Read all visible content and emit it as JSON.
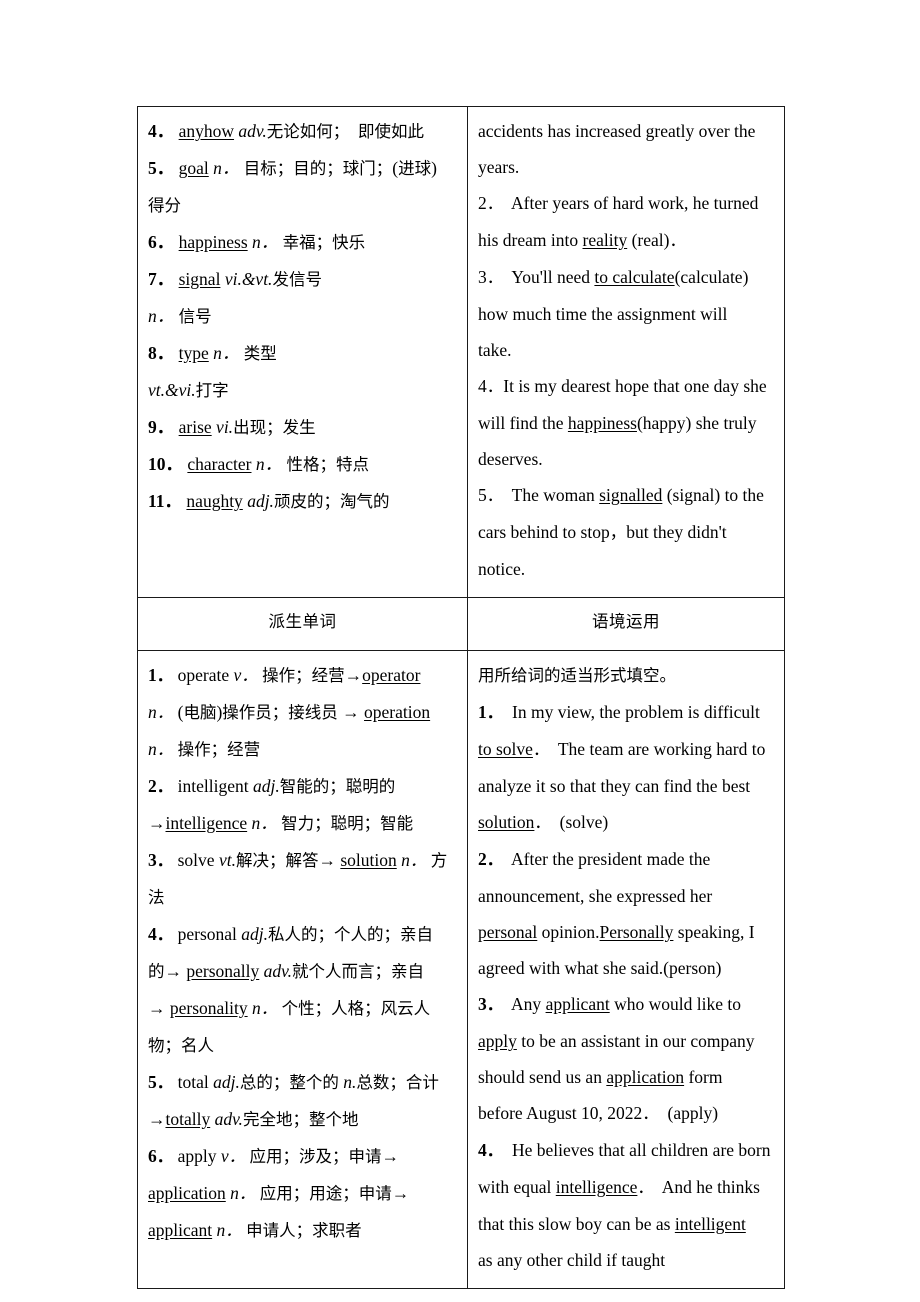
{
  "table": {
    "columns": [
      {
        "key": "left",
        "heading": "派生单词"
      },
      {
        "key": "right",
        "heading": "语境运用"
      }
    ],
    "row_words": {
      "left_cell": {
        "name": "word-list",
        "lines": [
          {
            "num": "4．",
            "word": "anyhow",
            "pos": "adv.",
            "gloss": "无论如何；  即使如此"
          },
          {
            "num": "5．",
            "word": "goal",
            "pos": "n．",
            "gloss": " 目标；目的；球门；(进球)"
          },
          {
            "num": "",
            "word": "",
            "pos": "",
            "gloss": "得分"
          },
          {
            "num": "6．",
            "word": "happiness",
            "pos": "n．",
            "gloss": " 幸福；快乐"
          },
          {
            "num": "7．",
            "word": "signal",
            "pos": "vi.&vt.",
            "gloss": "发信号"
          },
          {
            "num": "",
            "word": "",
            "pos": "n．",
            "gloss": " 信号"
          },
          {
            "num": "8．",
            "word": "type",
            "pos": "n．",
            "gloss": " 类型"
          },
          {
            "num": "",
            "word": "",
            "pos": "vt.&vi.",
            "gloss": "打字"
          },
          {
            "num": "9．",
            "word": "arise",
            "pos": "vi.",
            "gloss": "出现；发生"
          },
          {
            "num": "10．",
            "word": "character",
            "pos": "n．",
            "gloss": " 性格；特点"
          },
          {
            "num": "11．",
            "word": "naughty",
            "pos": "adj.",
            "gloss": "顽皮的；淘气的"
          }
        ]
      },
      "right_cell": {
        "name": "context-sentences-top",
        "lines": [
          "accidents has increased greatly over the",
          "years.",
          "2．  After years of hard work, he turned",
          "his dream into [[reality]] (real)．",
          "3．  You'll need [[to calculate]](calculate)",
          "how much time the assignment will",
          "take.",
          "4．It is my dearest hope that one day she",
          "will find the [[happiness]](happy) she truly",
          "deserves.",
          "5．  The woman [[signalled]] (signal) to the",
          "cars behind to stop，but they didn't",
          "notice."
        ]
      }
    },
    "row_derived": {
      "left_cell": {
        "name": "derived-word-list",
        "lines": [
          "[[b:1．]] operate [[i:v．]] 操作；经营→[[u:operator]]",
          "[[i:n．]] (电脑)操作员；接线员 → [[u:operation]]",
          "[[i:n．]] 操作；经营",
          "[[b:2．]] intelligent [[i:adj.]]智能的；聪明的",
          "→[[u:intelligence]] [[i:n．]] 智力；聪明；智能",
          "[[b:3．]] solve [[i:vt.]]解决；解答→ [[u:solution]] [[i:n．]] 方",
          "法",
          "[[b:4．]] personal [[i:adj.]]私人的；个人的；亲自",
          "的→ [[u:personally]] [[i:adv.]]就个人而言；亲自",
          "→ [[u:personality]] [[i:n．]] 个性；人格；风云人",
          "物；名人",
          "[[b:5．]] total [[i:adj.]]总的；整个的 [[i:n.]]总数；合计",
          "→[[u:totally]] [[i:adv.]]完全地；整个地",
          "[[b:6．]] apply [[i:v．]] 应用；涉及；申请→",
          "[[u:application]] [[i:n．]] 应用；用途；申请→",
          "[[u:applicant]] [[i:n．]] 申请人；求职者"
        ]
      },
      "right_cell": {
        "name": "context-exercise",
        "instruction": "用所给词的适当形式填空。",
        "lines": [
          "[[b:1．]]  In my view, the problem is difficult",
          "[[u:to solve]]．  The team are working hard to",
          "analyze it so that they can find the best",
          "[[u:solution]]．  (solve)",
          "[[b:2．]]  After the president made the",
          "announcement, she expressed her",
          "[[u:personal]] opinion.[[u:Personally]] speaking, I",
          "agreed with what she said.(person)",
          "[[b:3．]]  Any [[u:applicant]] who would like to",
          "[[u:apply]] to be an assistant in our company",
          "should send us an [[u:application]] form",
          "before August 10, 2022．  (apply)",
          "[[b:4．]]  He believes that all children are born",
          "with equal [[u:intelligence]]．  And he thinks",
          "that this slow boy can be as [[u:intelligent]]",
          "as any other child if taught"
        ]
      }
    }
  }
}
